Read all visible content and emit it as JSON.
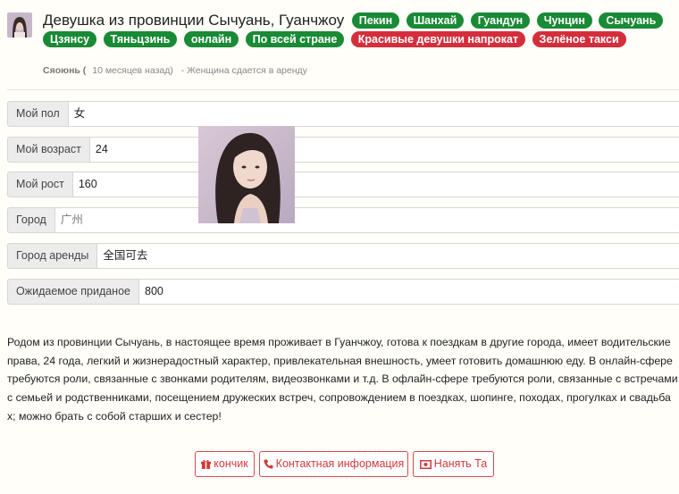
{
  "post": {
    "title": "Девушка из провинции Сычуань, Гуанчжоу",
    "tags_green": [
      "Пекин",
      "Шанхай",
      "Гуандун",
      "Чунцин",
      "Сычуань",
      "Цзянсу",
      "Тяньцзинь",
      "онлайн",
      "По всей стране"
    ],
    "tags_red": [
      "Красивые девушки напрокат",
      "Зелёное такси"
    ],
    "author": "Сяоюнь (",
    "time": "10 месяцев назад)",
    "subtitle": "- Женщина сдается в аренду"
  },
  "fields": [
    {
      "label": "Мой пол",
      "value": "女"
    },
    {
      "label": "Мой возраст",
      "value": "24"
    },
    {
      "label": "Мой рост",
      "value": "160"
    },
    {
      "label": "Город",
      "value": "广州"
    },
    {
      "label": "Город аренды",
      "value": "全国可去"
    },
    {
      "label": "Ожидаемое приданое",
      "value": "800"
    }
  ],
  "description": "Родом из провинции Сычуань, в настоящее время проживает в Гуанчжоу, готова к поездкам в другие города, имеет водительские права, 24 года, легкий и жизнерадостный характер, привлекательная внешность, умеет готовить домашнюю еду. В онлайн-сфере требуются роли, связанные с звонками родителям, видеозвонками и т.д. В офлайн-сфере требуются роли, связанные с встречами с семьей и родственниками, посещением дружеских встреч, сопровождением в поездках, шопинге, походах, прогулках и свадьбах; можно брать с собой старших и сестер!",
  "buttons": {
    "tip": "кончик",
    "contact": "Контактная информация",
    "hire": "Нанять Та"
  },
  "icons": {
    "tip": "gift-icon",
    "contact": "phone-icon",
    "hire": "money-icon"
  },
  "colors": {
    "tag_green": "#198a35",
    "tag_red": "#d42e3c",
    "button_red": "#d23a3a"
  }
}
